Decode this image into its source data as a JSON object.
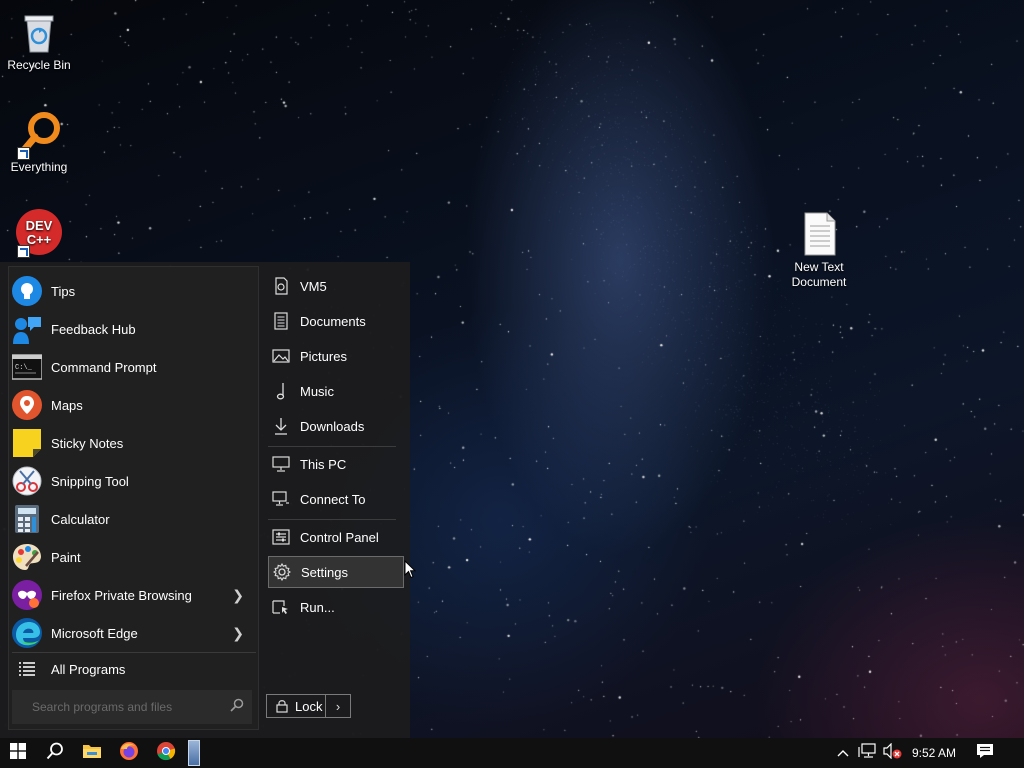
{
  "desktop": {
    "icons": [
      {
        "label": "Recycle Bin",
        "icon": "recycle-bin-icon"
      },
      {
        "label": "Everything",
        "icon": "everything-search-icon"
      },
      {
        "label": "DEV C++",
        "icon": "dev-cpp-icon"
      },
      {
        "label": "New Text Document",
        "icon": "text-document-icon"
      }
    ]
  },
  "start_menu": {
    "programs": [
      {
        "label": "Tips",
        "icon": "lightbulb-icon",
        "has_submenu": false
      },
      {
        "label": "Feedback Hub",
        "icon": "feedback-hub-icon",
        "has_submenu": false
      },
      {
        "label": "Command Prompt",
        "icon": "command-prompt-icon",
        "has_submenu": false
      },
      {
        "label": "Maps",
        "icon": "map-pin-icon",
        "has_submenu": false
      },
      {
        "label": "Sticky Notes",
        "icon": "sticky-notes-icon",
        "has_submenu": false
      },
      {
        "label": "Snipping Tool",
        "icon": "snipping-tool-icon",
        "has_submenu": false
      },
      {
        "label": "Calculator",
        "icon": "calculator-icon",
        "has_submenu": false
      },
      {
        "label": "Paint",
        "icon": "paint-palette-icon",
        "has_submenu": false
      },
      {
        "label": "Firefox Private Browsing",
        "icon": "firefox-private-icon",
        "has_submenu": true
      },
      {
        "label": "Microsoft Edge",
        "icon": "edge-icon",
        "has_submenu": true
      }
    ],
    "all_programs_label": "All Programs",
    "search_placeholder": "Search programs and files",
    "places": [
      {
        "label": "VM5",
        "icon": "user-icon"
      },
      {
        "label": "Documents",
        "icon": "documents-icon"
      },
      {
        "label": "Pictures",
        "icon": "pictures-icon"
      },
      {
        "label": "Music",
        "icon": "music-note-icon"
      },
      {
        "label": "Downloads",
        "icon": "download-arrow-icon"
      },
      {
        "label": "This PC",
        "icon": "monitor-icon"
      },
      {
        "label": "Connect To",
        "icon": "connect-icon"
      },
      {
        "label": "Control Panel",
        "icon": "control-panel-icon"
      },
      {
        "label": "Settings",
        "icon": "gear-icon",
        "highlighted": true
      },
      {
        "label": "Run...",
        "icon": "run-icon"
      }
    ],
    "lock_label": "Lock",
    "lock_arrow": "›"
  },
  "taskbar": {
    "clock": "9:52 AM",
    "pinned": [
      "start-windows-icon",
      "search-icon",
      "file-explorer-icon",
      "firefox-icon",
      "chrome-icon",
      "active-app-icon"
    ],
    "tray": [
      "chevron-up-icon",
      "network-icon",
      "volume-muted-icon",
      "notification-icon"
    ]
  }
}
